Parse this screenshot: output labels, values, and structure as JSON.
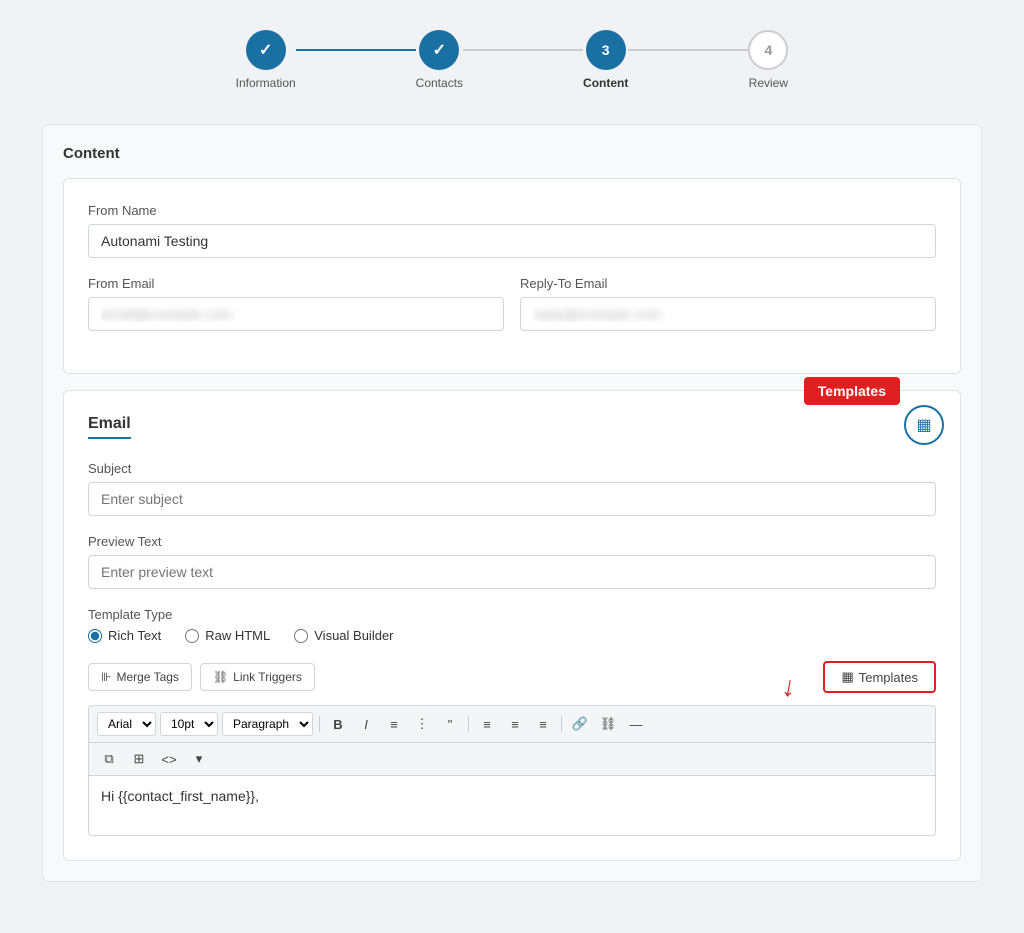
{
  "stepper": {
    "steps": [
      {
        "id": "information",
        "label": "Information",
        "state": "completed",
        "number": "✓"
      },
      {
        "id": "contacts",
        "label": "Contacts",
        "state": "completed",
        "number": "✓"
      },
      {
        "id": "content",
        "label": "Content",
        "state": "active",
        "number": "3"
      },
      {
        "id": "review",
        "label": "Review",
        "state": "inactive",
        "number": "4"
      }
    ]
  },
  "content_section": {
    "title": "Content"
  },
  "form": {
    "from_name_label": "From Name",
    "from_name_value": "Autonami Testing",
    "from_email_label": "From Email",
    "from_email_placeholder": "email@example.com",
    "reply_to_label": "Reply-To Email",
    "reply_to_placeholder": "reply@example.com"
  },
  "email_section": {
    "title": "Email",
    "templates_badge": "Templates",
    "subject_label": "Subject",
    "subject_placeholder": "Enter subject",
    "preview_text_label": "Preview Text",
    "preview_text_placeholder": "Enter preview text",
    "template_type_label": "Template Type",
    "template_types": [
      {
        "id": "rich_text",
        "label": "Rich Text",
        "checked": true
      },
      {
        "id": "raw_html",
        "label": "Raw HTML",
        "checked": false
      },
      {
        "id": "visual_builder",
        "label": "Visual Builder",
        "checked": false
      }
    ],
    "merge_tags_btn": "Merge Tags",
    "link_triggers_btn": "Link Triggers",
    "templates_btn": "Templates"
  },
  "editor": {
    "font_family": "Arial",
    "font_size": "10pt",
    "paragraph": "Paragraph",
    "body_content": "Hi {{contact_first_name}},"
  },
  "icons": {
    "templates_icon": "▦",
    "merge_tags_icon": "⊪",
    "link_triggers_icon": "⛓",
    "bold": "B",
    "italic": "I",
    "ul": "≡",
    "ol": "≡",
    "quote": "❝",
    "align_left": "≡",
    "align_center": "≡",
    "align_right": "≡",
    "link": "🔗",
    "unlink": "⛓",
    "hr": "—",
    "copy": "⧉",
    "table": "⊞",
    "code": "<>",
    "more": "▾"
  }
}
